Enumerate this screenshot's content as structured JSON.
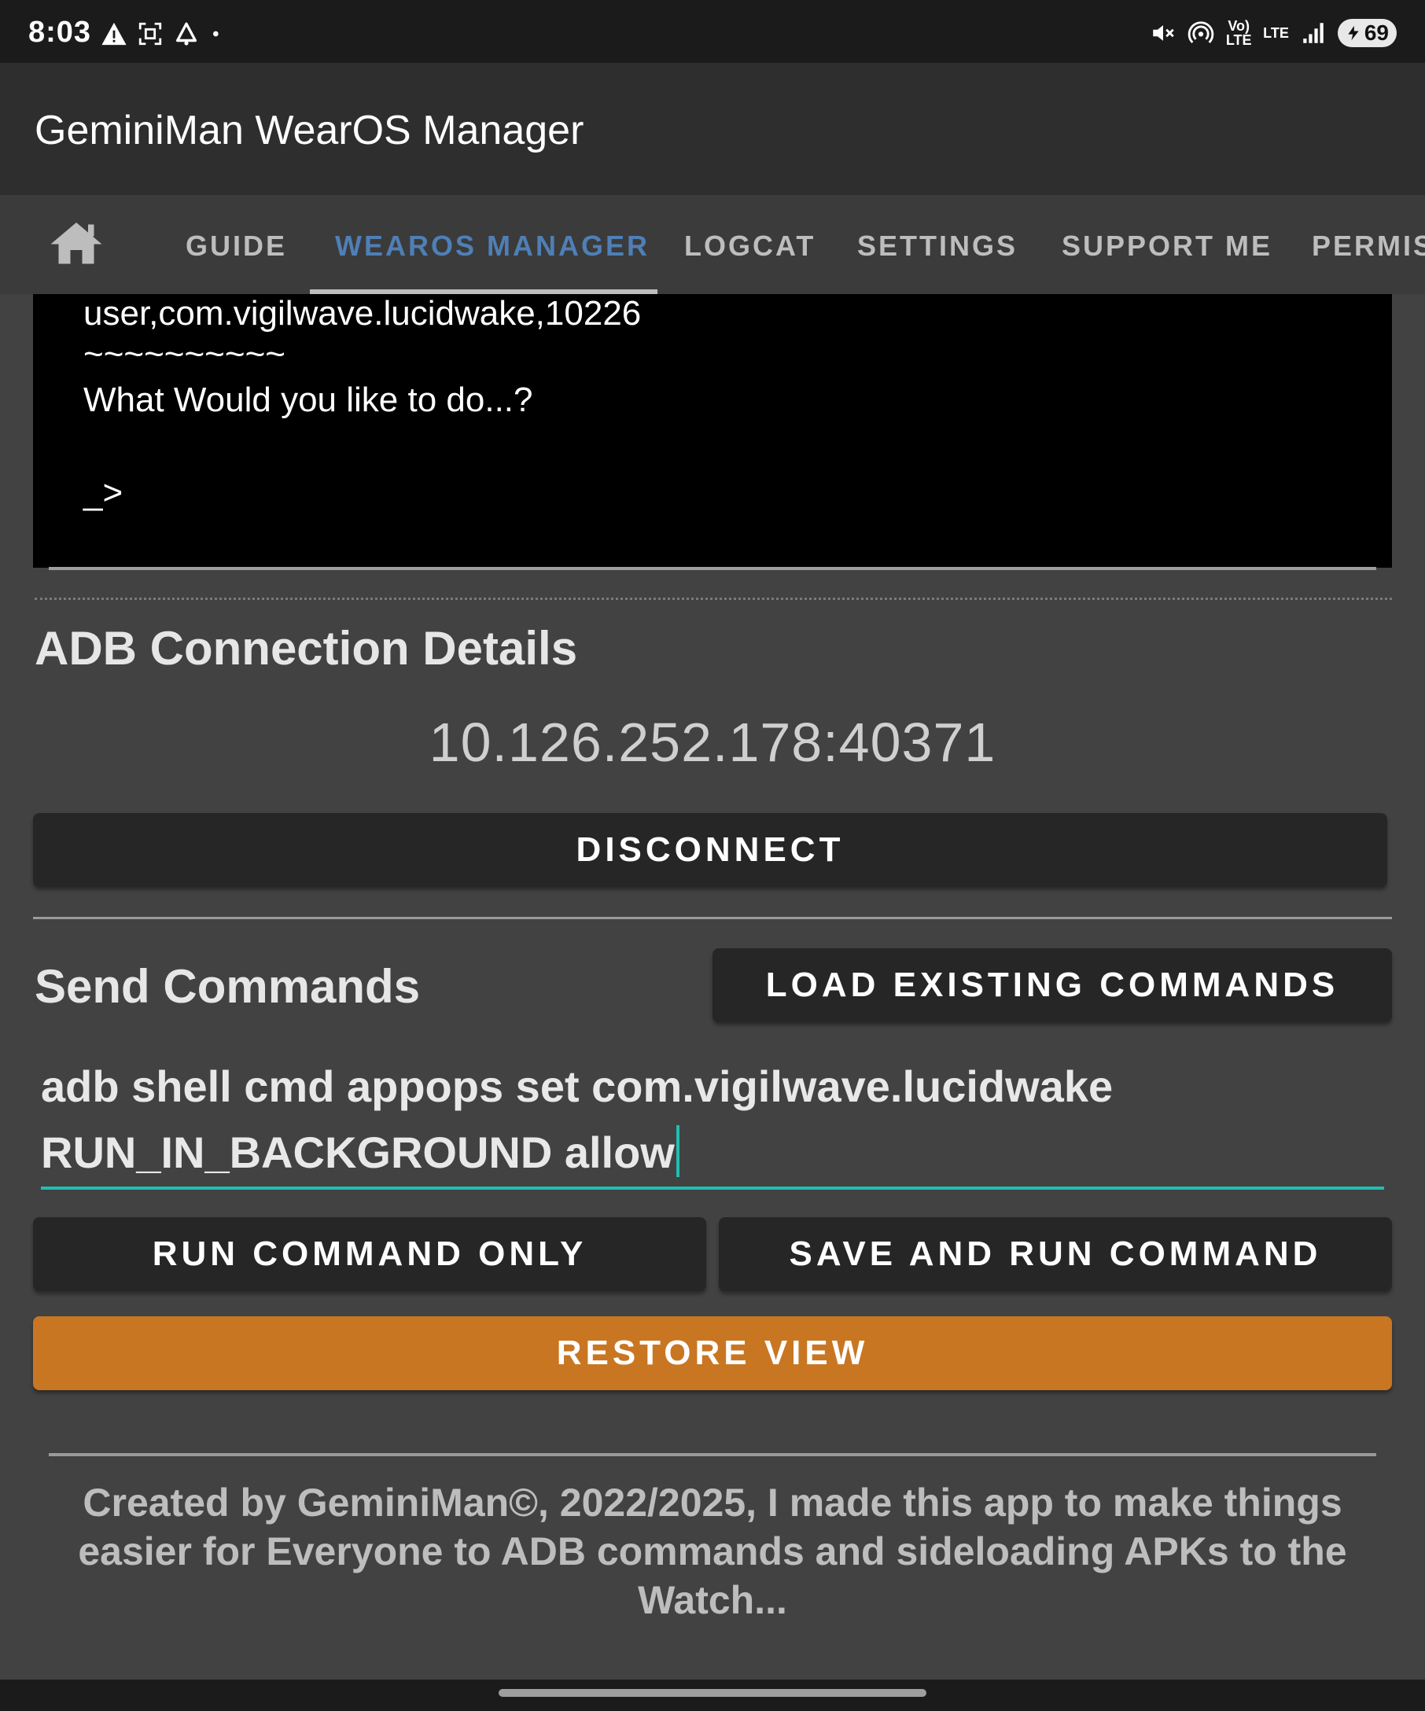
{
  "status_bar": {
    "time": "8:03",
    "battery_level": "69",
    "left_icons": [
      "warning-icon",
      "screenshot-icon",
      "alarm-icon",
      "dot-icon"
    ],
    "right_icons": [
      "mute-icon",
      "hotspot-icon",
      "volte-icon",
      "lte-icon",
      "signal-icon",
      "battery-charging-icon"
    ],
    "volte_label": "Vo) LTE",
    "lte_label": "LTE"
  },
  "app_bar": {
    "title": "GeminiMan WearOS Manager"
  },
  "tabs": [
    {
      "label": "GUIDE"
    },
    {
      "label": "WEAROS MANAGER",
      "active": true
    },
    {
      "label": "LOGCAT"
    },
    {
      "label": "SETTINGS"
    },
    {
      "label": "SUPPORT ME"
    },
    {
      "label": "PERMIS"
    }
  ],
  "terminal": {
    "lines": [
      "user,com.vigilwave.lucidwake,10226",
      "~~~~~~~~~~",
      "What Would you like to do...?",
      "",
      "_>"
    ]
  },
  "adb": {
    "title": "ADB Connection Details",
    "address": "10.126.252.178:40371",
    "disconnect_label": "DISCONNECT"
  },
  "commands": {
    "title": "Send Commands",
    "load_label": "LOAD EXISTING COMMANDS",
    "input_line1": "adb shell cmd appops set com.vigilwave.lucidwake",
    "input_line2": "RUN_IN_BACKGROUND allow",
    "run_only_label": "RUN COMMAND ONLY",
    "save_run_label": "SAVE AND RUN COMMAND",
    "restore_label": "RESTORE VIEW"
  },
  "footer": {
    "text": "Created by GeminiMan©, 2022/2025, I made this app to make things easier for Everyone to ADB commands and sideloading APKs to the Watch..."
  },
  "colors": {
    "accent_tab": "#4f7fb5",
    "input_accent": "#1fbfb0",
    "restore_button": "#c97622",
    "background": "#424242"
  }
}
